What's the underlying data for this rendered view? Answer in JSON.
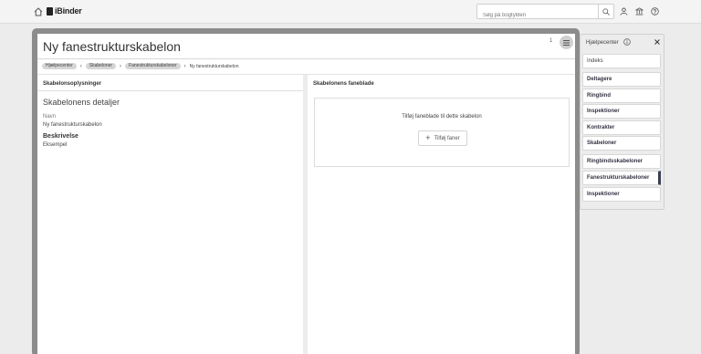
{
  "topbar": {
    "logo_text": "iBinder",
    "search_placeholder": "Søg på bogtylden"
  },
  "card": {
    "title": "Ny fanestrukturskabelon",
    "count": "1",
    "breadcrumb": [
      "Hjælpecenter",
      "Skabeloner",
      "Fanestrukturskabeloner"
    ],
    "breadcrumb_current": "Ny fanestrukturskabelon"
  },
  "left": {
    "heading": "Skabelonsoplysninger",
    "details_title": "Skabelonens detaljer",
    "name_label": "Navn",
    "name_value": "Ny fanestrukturskabelon",
    "description_label": "Beskrivelse",
    "description_value": "Eksempel"
  },
  "right": {
    "heading": "Skabelonens faneblade",
    "empty_text": "Tilføj faneblade til dette skabelon",
    "add_button": "Tilføj faner"
  },
  "help": {
    "title": "Hjælpecenter",
    "items": [
      "Indeks",
      "Deltagere",
      "Ringbind",
      "Inspektioner",
      "Kontrakter",
      "Skabeloner"
    ],
    "subitems": [
      "Ringbindsskabeloner",
      "Fanestrukturskabeloner",
      "Inspektioner"
    ],
    "active_subitem": "Fanestrukturskabeloner"
  }
}
